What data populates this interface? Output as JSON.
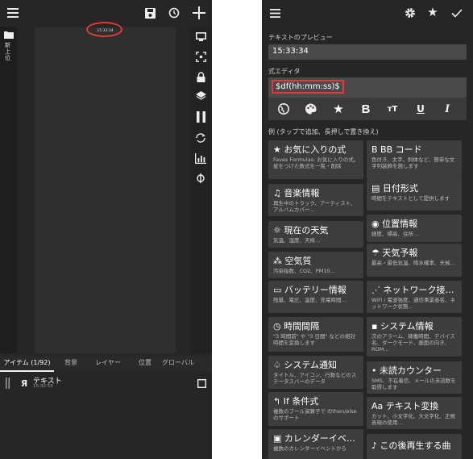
{
  "left_screen": {
    "canvas_clock": "15:33:34",
    "folder_label": "新上位",
    "tabs": [
      "アイテム (1/92)",
      "背景",
      "レイヤー",
      "位置",
      "グローバル"
    ],
    "item": {
      "name": "テキスト",
      "time": "15:32:53"
    }
  },
  "right_screen": {
    "preview_label": "テキストのプレビュー",
    "preview_value": "15:33:34",
    "editor_label": "式エディタ",
    "editor_value": "$df(hh:mm:ss)$",
    "examples_label": "例 (タップで追加、長押しで置き換え)",
    "cards_left": [
      {
        "title": "★ お気に入りの式",
        "desc": "Faves Formulas: お気に入りの式。星をつけた数式を一覧・削除"
      },
      {
        "title": "♫ 音楽情報",
        "desc": "再生中のトラック、アーティスト、アルバムカバー…"
      },
      {
        "title": "☼ 現在の天気",
        "desc": "気温、湿度、天候…"
      },
      {
        "title": "⁂ 空気質",
        "desc": "汚染指数、CO2、PM10…"
      },
      {
        "title": "▭ バッテリー情報",
        "desc": "残量、電圧、温度、充電時間…"
      },
      {
        "title": "◷ 時間間隔",
        "desc": "\"3 時間前\" や \"3 日間\" などの相対時間を変換します"
      },
      {
        "title": "♤ システム通知",
        "desc": "タイトル、アイコン、行数などのステータスバーのデータ"
      },
      {
        "title": "↰ If 条件式",
        "desc": "複数のブール演算子で if/then/else のサポート"
      },
      {
        "title": "▣ カレンダーイベ…",
        "desc": "複数のカレンダーイベントから"
      }
    ],
    "cards_right": [
      {
        "title": "B BB コード",
        "desc": "色付き、太字、斜体など、簡単な文字列装飾を施します"
      },
      {
        "title": "▤ 日付形式",
        "desc": "時間をテキストとして提供します"
      },
      {
        "title": "◉ 位置情報",
        "desc": "経度、標高、住所…"
      },
      {
        "title": "☂ 天気予報",
        "desc": "最高・最低気温、降水確率、天候…"
      },
      {
        "title": "⋰ ネットワーク接…",
        "desc": "WiFi / 電波強度、通信事業者名、ネットワーク状態…"
      },
      {
        "title": "▪ システム情報",
        "desc": "次のアラーム、稼働時間、デバイス名、ダークモード、画面の向き、ROM…"
      },
      {
        "title": "• 未読カウンター",
        "desc": "SMS、不在着信、メールの未読数を取得します"
      },
      {
        "title": "Aa テキスト変換",
        "desc": "カット、小文字化、大文字化、正規表現の使用…"
      },
      {
        "title": "♪ この後再生する曲",
        "desc": ""
      }
    ]
  },
  "icons": [
    "hamburger-menu-icon",
    "save-icon",
    "history-icon",
    "add-icon",
    "folder-icon",
    "preview-icon",
    "target-icon",
    "lock-icon",
    "layers-icon",
    "pause-icon",
    "rotate-icon",
    "stats-icon",
    "visibility-icon",
    "gear-icon",
    "star-icon",
    "check-icon",
    "globe-icon",
    "palette-icon",
    "bold-icon",
    "text-size-icon",
    "underline-icon",
    "italic-icon",
    "drag-handle-icon",
    "text-item-icon",
    "checkbox-icon"
  ],
  "colors": {
    "highlight": "#e53935",
    "background": "#262626",
    "card": "#3d3d3d",
    "field": "#4a4a4a"
  }
}
